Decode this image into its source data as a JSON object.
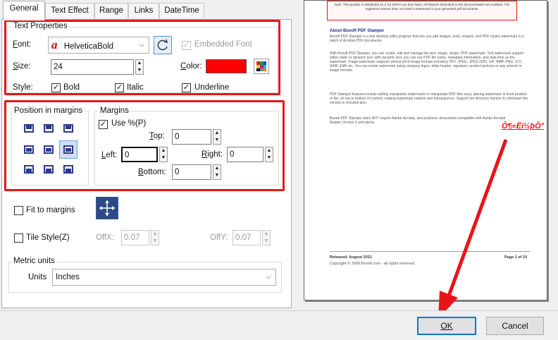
{
  "tabs": [
    "General",
    "Text Effect",
    "Range",
    "Links",
    "DateTime"
  ],
  "text_properties": {
    "legend": "Text Properties",
    "font_label": "Font:",
    "font_value": "HelveticaBold",
    "embedded_font_label": "Embedded Font",
    "embedded_font_checked": true,
    "size_label": "Size:",
    "size_value": "24",
    "color_label": "Color:",
    "color_value": "#ff0000",
    "style_label": "Style:",
    "bold_label": "Bold",
    "bold_checked": true,
    "italic_label": "Italic",
    "italic_checked": true,
    "underline_label": "Underline",
    "underline_checked": true
  },
  "position": {
    "legend": "Position in margins",
    "selected": "middle-right"
  },
  "margins": {
    "legend": "Margins",
    "use_percent_label": "Use %(P)",
    "use_percent_checked": true,
    "top_label": "Top:",
    "top_value": "0",
    "left_label": "Left:",
    "left_value": "0",
    "right_label": "Right:",
    "right_value": "0",
    "bottom_label": "Bottom:",
    "bottom_value": "0"
  },
  "fit_to_margins_label": "Fit to margins",
  "tile": {
    "label": "Tile Style(Z)",
    "offx_label": "OffX:",
    "offx_value": "0.07",
    "offy_label": "OffY:",
    "offy_value": "0.07"
  },
  "metric": {
    "legend": "Metric units",
    "units_label": "Units",
    "units_value": "Inches"
  },
  "preview": {
    "notice": "Note: This product is distributed on a 'try before you buy' basis. All features described in this documentation are enabled. The registered version does not insert a watermark in your generated pdf documents.",
    "heading": "About Boxoft PDF Stamper",
    "para1": "Boxoft PDF Stamper is a fast desktop utility program that lets you add images, texts, shapes, and PDF (style) watermark to a batch of Acrobat PDF documents.",
    "para2": "With Boxoft PDF Stamper, you can create, edit and manage the text, image, shape, PDF watermark. Text watermark support either static or dynamic text, with dynamic text, you can use PDF file name, metadata information, and date time as the watermark. Image watermark supports almost all of image formats including TIFF, JPEG, JPEG 2000, GIF, BMP, PNG, ICO, WMF, EMF etc. You can create watermark using company logos, letter header, signature, product pictures or any artwork in image formats.",
    "para3": "PDF Stamper features include adding manipulate watermarks in manipulate PDF files easy, placing watermark in fixed position or tile, on top or bottom of content; making watermark rotation and transparence. Support hot directory monitor & command line version is included also.",
    "para4": "Boxoft PDF Stamper does NOT require Adobe Acrobat, and produces documents compatible with Adobe Acrobat Reader Version 5 and above.",
    "stamp": "Ô¶«Ëí½þÔ°",
    "released": "Released: August 2011",
    "page": "Page 1 of 10",
    "copyright": "Copyright © 2006 Boxoft.com - all rights reserved"
  },
  "ok_label": "OK",
  "cancel_label": "Cancel",
  "accent_red": "#e8141a",
  "accent_blue": "#0078d7"
}
